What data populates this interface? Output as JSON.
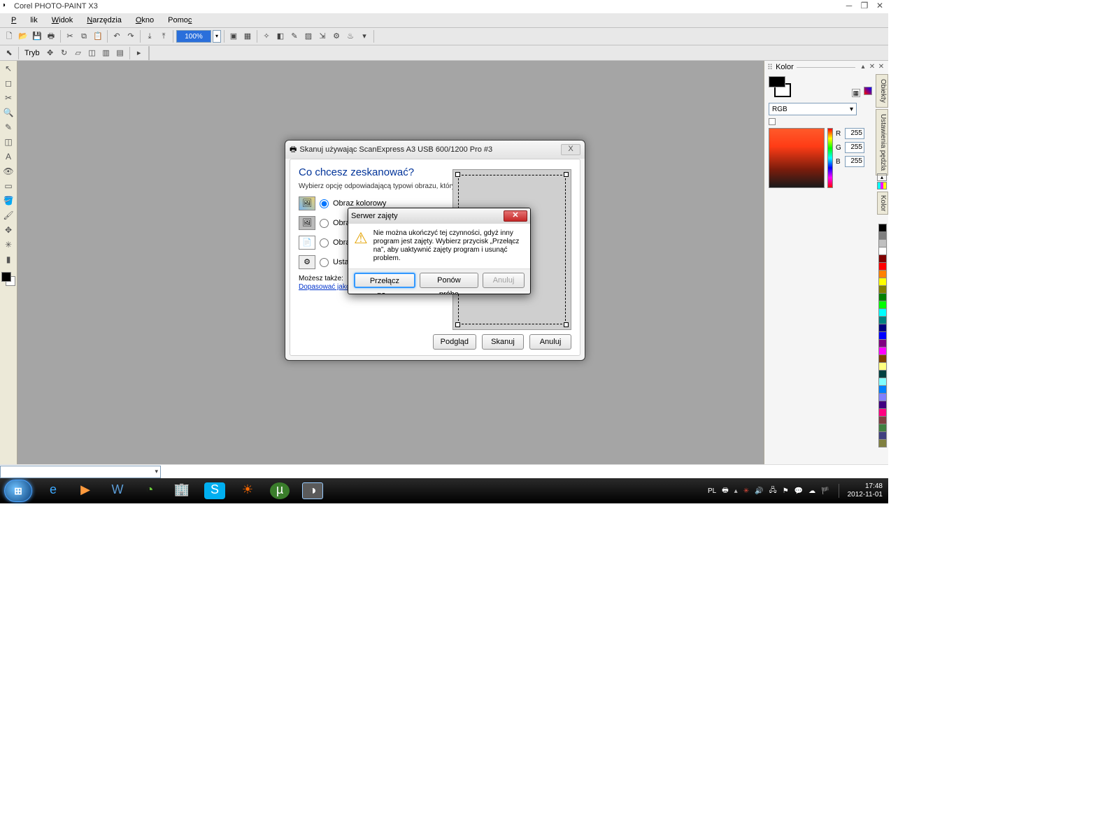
{
  "titlebar": {
    "title": "Corel PHOTO-PAINT X3"
  },
  "menu": {
    "file": "Plik",
    "view": "Widok",
    "tools": "Narzędzia",
    "window": "Okno",
    "help": "Pomoc"
  },
  "toolbar": {
    "zoom": "100%",
    "tryb": "Tryb"
  },
  "colorDock": {
    "title": "Kolor",
    "mode": "RGB",
    "r": "255",
    "g": "255",
    "b": "255",
    "r_lab": "R",
    "g_lab": "G",
    "b_lab": "B"
  },
  "vtabs": {
    "t1": "Obiekty",
    "t2": "Ustawienia pędzla",
    "t3": "Kolor"
  },
  "palette": [
    "#000000",
    "#7f7f7f",
    "#c0c0c0",
    "#ffffff",
    "#800000",
    "#ff0000",
    "#ff8000",
    "#ffff00",
    "#808000",
    "#008000",
    "#00ff00",
    "#00ffff",
    "#008080",
    "#000080",
    "#0000ff",
    "#800080",
    "#ff00ff",
    "#804000",
    "#ffff80",
    "#004040",
    "#80ffff",
    "#0080ff",
    "#8080ff",
    "#400080",
    "#ff0080",
    "#804040",
    "#408040",
    "#404080",
    "#808040"
  ],
  "scanDlg": {
    "title": "Skanuj używając ScanExpress A3 USB 600/1200 Pro #3",
    "heading": "Co chcesz zeskanować?",
    "subtext": "Wybierz opcję odpowiadającą typowi obrazu, który chcesz zeskanować.",
    "opt1": "Obraz kolorowy",
    "opt2": "Obraz w skali szarości",
    "opt3": "Obraz czarno-biały lub tekst",
    "opt4": "Ustawienia niestandardowe",
    "also": "Możesz także:",
    "link": "Dopasować jakość skanowanego obrazu",
    "preview": "Podgląd",
    "scan": "Skanuj",
    "cancel": "Anuluj"
  },
  "errDlg": {
    "title": "Serwer zajęty",
    "msg": "Nie można ukończyć tej czynności, gdyż inny program jest zajęty. Wybierz przycisk „Przełącz na”, aby uaktywnić zajęty program i usunąć problem.",
    "switch": "Przełącz na...",
    "retry": "Ponów próbę",
    "cancel": "Anuluj"
  },
  "taskbar": {
    "lang": "PL",
    "time": "17:48",
    "date": "2012-11-01"
  }
}
